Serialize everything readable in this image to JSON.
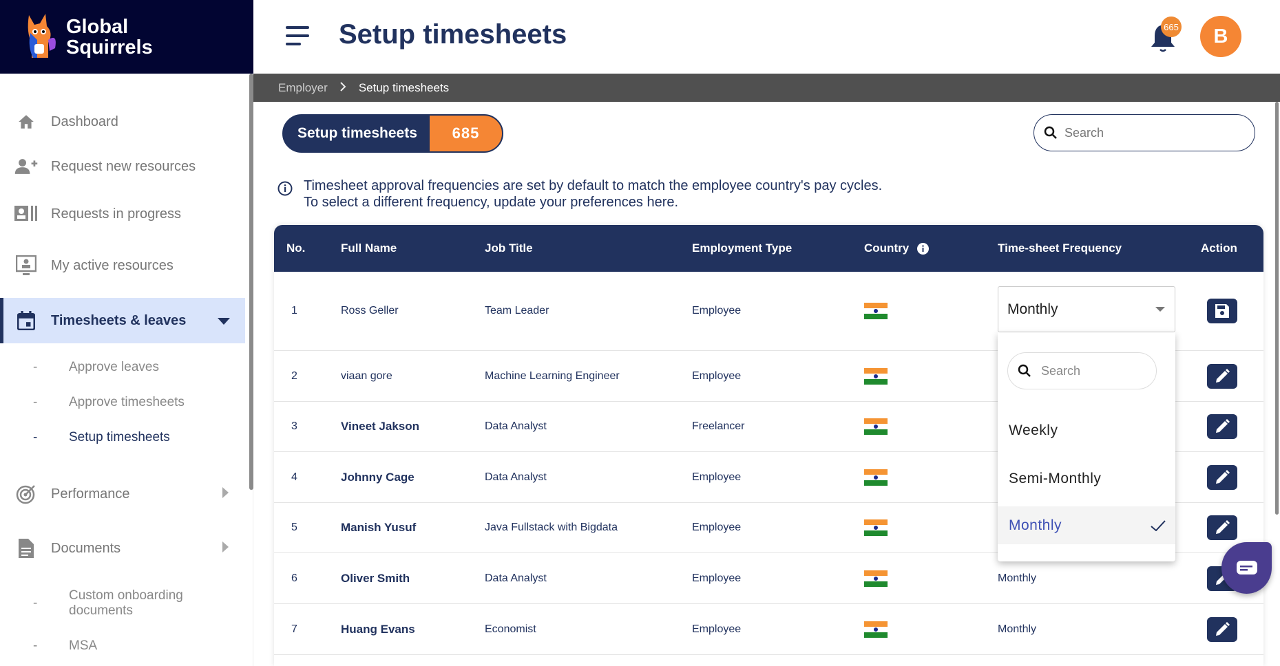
{
  "brand": {
    "name_line1": "Global",
    "name_line2": "Squirrels"
  },
  "header": {
    "title": "Setup timesheets",
    "notification_count": "665",
    "avatar_initial": "B"
  },
  "breadcrumb": {
    "items": [
      "Employer",
      "Setup timesheets"
    ]
  },
  "sidebar": {
    "items": [
      {
        "label": "Dashboard",
        "icon": "home-icon"
      },
      {
        "label": "Request new resources",
        "icon": "person-add-icon"
      },
      {
        "label": "Requests in progress",
        "icon": "id-card-icon"
      },
      {
        "label": "My active resources",
        "icon": "monitor-person-icon"
      },
      {
        "label": "Timesheets & leaves",
        "icon": "calendar-icon",
        "active": true
      },
      {
        "label": "Performance",
        "icon": "target-icon"
      },
      {
        "label": "Documents",
        "icon": "document-icon"
      }
    ],
    "timesheet_subitems": [
      {
        "label": "Approve leaves"
      },
      {
        "label": "Approve timesheets"
      },
      {
        "label": "Setup timesheets",
        "active": true
      }
    ],
    "document_subitems": [
      {
        "label": "Custom onboarding documents"
      },
      {
        "label": "MSA"
      }
    ]
  },
  "summary": {
    "label": "Setup timesheets",
    "count": "685"
  },
  "search": {
    "placeholder": "Search"
  },
  "info": {
    "line1": "Timesheet approval frequencies are set by default to match the employee country's pay cycles.",
    "line2": "To select a different frequency, update your preferences here."
  },
  "table": {
    "columns": [
      "No.",
      "Full Name",
      "Job Title",
      "Employment Type",
      "Country",
      "Time-sheet Frequency",
      "Action"
    ],
    "rows": [
      {
        "no": "1",
        "name": "Ross Geller",
        "job": "Team Leader",
        "type": "Employee",
        "country": "India",
        "frequency": "",
        "action": "save"
      },
      {
        "no": "2",
        "name": "viaan gore",
        "job": "Machine Learning Engineer",
        "type": "Employee",
        "country": "India",
        "frequency": "",
        "action": "edit"
      },
      {
        "no": "3",
        "name": "Vineet Jakson",
        "job": "Data Analyst",
        "type": "Freelancer",
        "country": "India",
        "frequency": "",
        "action": "edit"
      },
      {
        "no": "4",
        "name": "Johnny Cage",
        "job": "Data Analyst",
        "type": "Employee",
        "country": "India",
        "frequency": "",
        "action": "edit"
      },
      {
        "no": "5",
        "name": "Manish Yusuf",
        "job": "Java Fullstack with Bigdata",
        "type": "Employee",
        "country": "India",
        "frequency": "",
        "action": "edit"
      },
      {
        "no": "6",
        "name": "Oliver Smith",
        "job": "Data Analyst",
        "type": "Employee",
        "country": "India",
        "frequency": "Monthly",
        "action": "edit"
      },
      {
        "no": "7",
        "name": "Huang Evans",
        "job": "Economist",
        "type": "Employee",
        "country": "India",
        "frequency": "Monthly",
        "action": "edit"
      }
    ]
  },
  "frequency_dropdown": {
    "selected": "Monthly",
    "search_placeholder": "Search",
    "options": [
      "Weekly",
      "Semi-Monthly",
      "Monthly"
    ]
  },
  "colors": {
    "navy": "#21325e",
    "brand_dark": "#020532",
    "orange": "#f58634",
    "active_bg": "#d9e4fb",
    "selected_option": "#3f51b5",
    "chat": "#4a3d8f"
  }
}
